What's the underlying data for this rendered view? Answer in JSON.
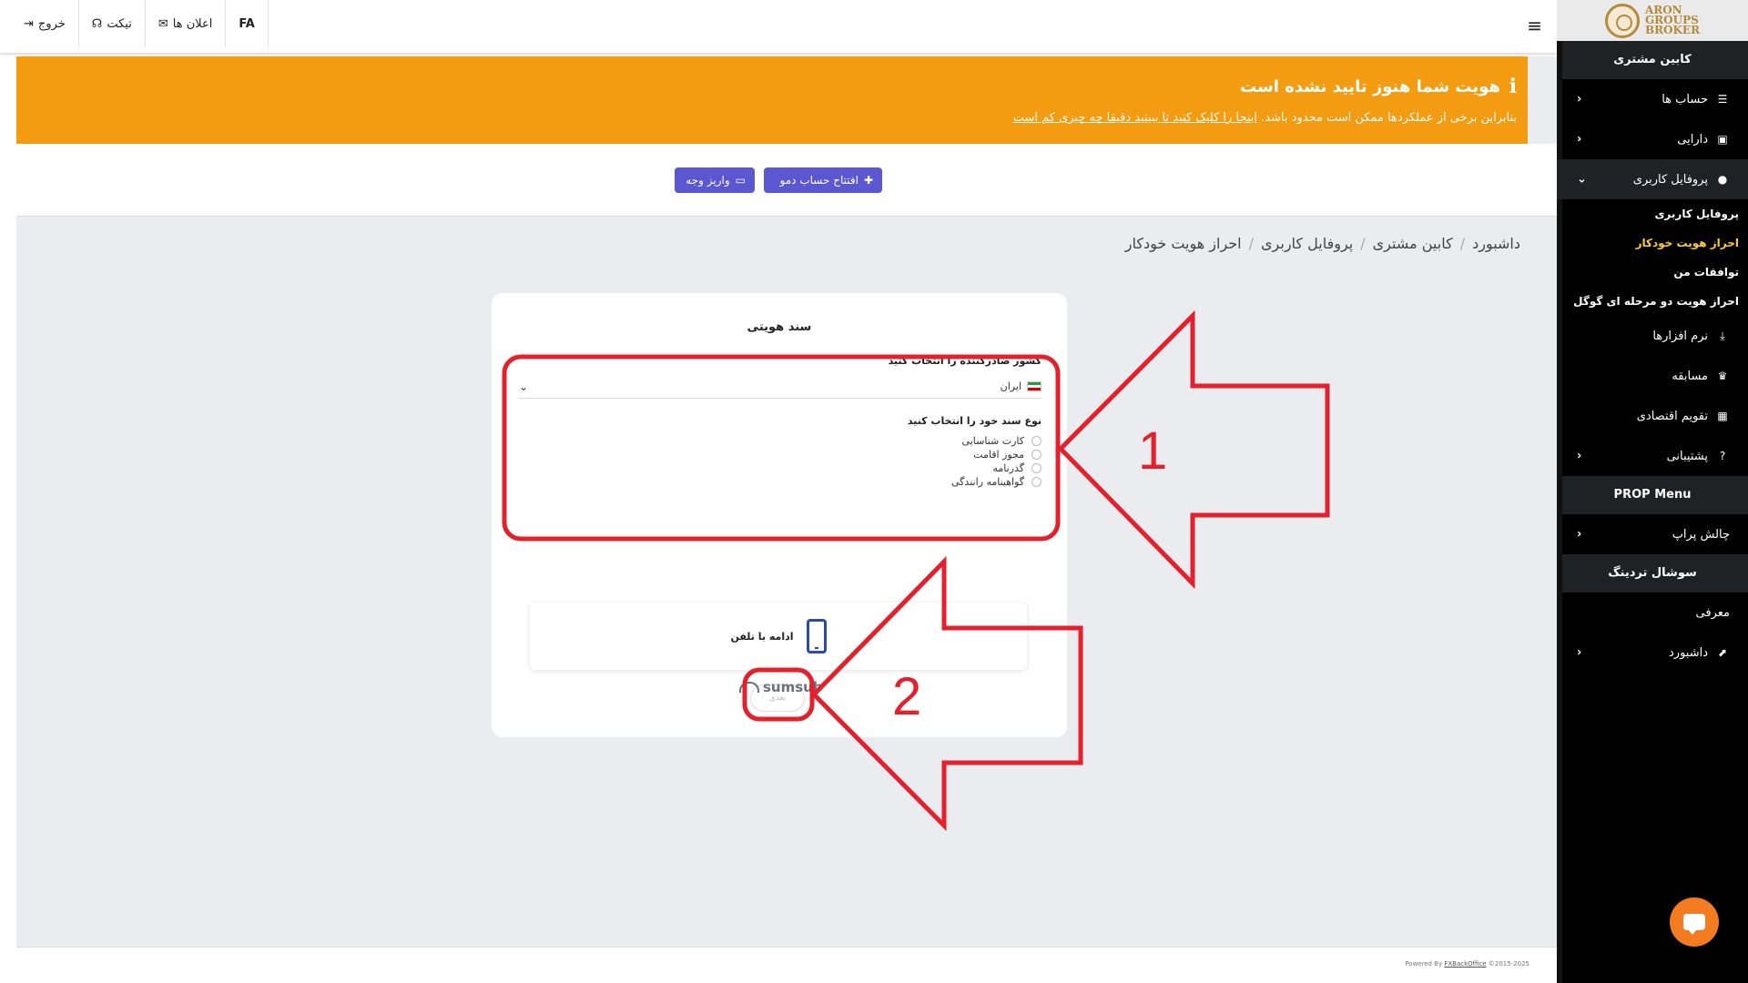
{
  "logo": {
    "line1": "ARON",
    "line2": "GROUPS",
    "line3": "BROKER"
  },
  "sidebar": {
    "section_client": "کابین مشتری",
    "items": [
      {
        "label": "حساب ها",
        "icon": "list-icon"
      },
      {
        "label": "دارایی",
        "icon": "wallet-icon"
      },
      {
        "label": "پروفایل کاربری",
        "icon": "user-icon"
      }
    ],
    "sub_items": [
      {
        "label": "پروفایل کاربری"
      },
      {
        "label": "احراز هویت خودکار"
      },
      {
        "label": "توافقات من"
      },
      {
        "label": "احراز هویت دو مرحله ای گوگل"
      }
    ],
    "items2": [
      {
        "label": "نرم افزارها",
        "icon": "download-icon"
      },
      {
        "label": "مسابقه",
        "icon": "trophy-icon"
      },
      {
        "label": "تقویم اقتصادی",
        "icon": "calendar-icon"
      },
      {
        "label": "پشتیبانی",
        "icon": "question-icon"
      }
    ],
    "section_prop": "PROP Menu",
    "prop_items": [
      {
        "label": "چالش پراپ"
      }
    ],
    "section_social": "سوشال تردینگ",
    "social_items": [
      {
        "label": "معرفی"
      },
      {
        "label": "داشبورد"
      }
    ]
  },
  "header": {
    "lang": "FA",
    "notifications": "اعلان ها",
    "ticket": "تیکت",
    "logout": "خروج"
  },
  "alert": {
    "title": "هویت شما هنوز تایید نشده است",
    "text_prefix": "بنابراین برخی از عملکردها ممکن است محدود باشد.",
    "link": "اینجا را کلیک کنید تا ببینید دقیقا چه چیزی کم است"
  },
  "actions": {
    "open_demo": "افتتاح حساب دمو",
    "deposit": "واریز وجه"
  },
  "breadcrumb": [
    "داشبورد",
    "کابین مشتری",
    "پروفایل کاربری",
    "احراز هویت خودکار"
  ],
  "verification": {
    "title": "سند هویتی",
    "country_label": "کشور صادرکننده را انتخاب کنید",
    "country_value": "ایران",
    "doc_type_label": "نوع سند خود را انتخاب کنید",
    "doc_types": [
      "کارت شناسایی",
      "مجوز اقامت",
      "گذرنامه",
      "گواهینامه رانندگی"
    ],
    "continue_phone": "ادامه با تلفن",
    "next": "بعدی"
  },
  "provider": "sumsub",
  "footer": {
    "powered": "Powered By",
    "brand": "FXBackOffice",
    "years": "©2015-2025"
  },
  "annotations": {
    "label1": "1",
    "label2": "2",
    "color": "#e3202b"
  },
  "colors": {
    "alert": "#f39c12",
    "primary_button": "#5b57d1",
    "sidebar": "#000000",
    "active_sub": "#ffcc33",
    "chat": "#f37b20"
  }
}
